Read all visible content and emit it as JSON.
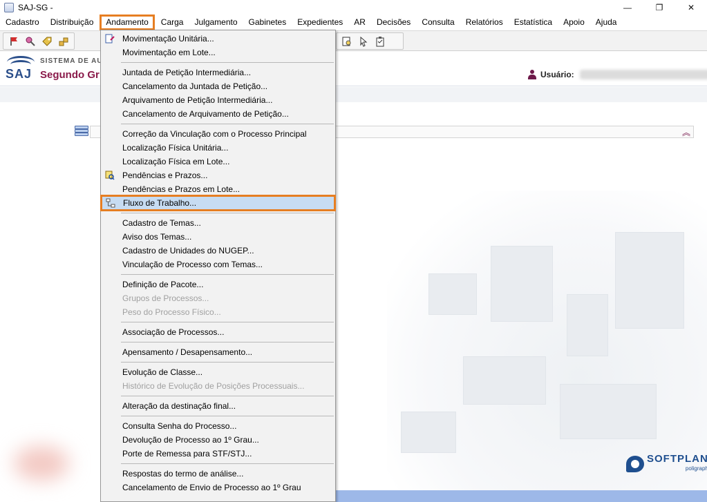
{
  "window": {
    "title": "SAJ-SG -",
    "minimize": "—",
    "restore": "❐",
    "close": "✕"
  },
  "menubar": {
    "items": [
      "Cadastro",
      "Distribuição",
      "Andamento",
      "Carga",
      "Julgamento",
      "Gabinetes",
      "Expedientes",
      "AR",
      "Decisões",
      "Consulta",
      "Relatórios",
      "Estatística",
      "Apoio",
      "Ajuda"
    ]
  },
  "header": {
    "logo_text": "SAJ",
    "system_name": "SISTEMA DE AUT",
    "subtitle": "Segundo Gr",
    "user_label": "Usuário:"
  },
  "brand": {
    "name": "SOFTPLAN",
    "sub": "poligraph"
  },
  "dropdown": {
    "group1": [
      "Movimentação Unitária...",
      "Movimentação em Lote..."
    ],
    "group2": [
      "Juntada de Petição Intermediária...",
      "Cancelamento da Juntada de Petição...",
      "Arquivamento de Petição Intermediária...",
      "Cancelamento de Arquivamento de Petição..."
    ],
    "group3": [
      "Correção da Vinculação com o Processo Principal",
      "Localização Física Unitária...",
      "Localização Física em Lote...",
      "Pendências e Prazos...",
      "Pendências e Prazos em Lote...",
      "Fluxo de Trabalho..."
    ],
    "group4": [
      "Cadastro de Temas...",
      "Aviso dos Temas...",
      "Cadastro de Unidades do NUGEP...",
      "Vinculação de Processo com Temas..."
    ],
    "group5": [
      "Definição de Pacote...",
      "Grupos de Processos...",
      "Peso do Processo Físico..."
    ],
    "group6": [
      "Associação de Processos..."
    ],
    "group7": [
      "Apensamento / Desapensamento..."
    ],
    "group8": [
      "Evolução de Classe...",
      "Histórico de Evolução de Posições Processuais..."
    ],
    "group9": [
      "Alteração da destinação final..."
    ],
    "group10": [
      "Consulta Senha do Processo...",
      "Devolução de Processo ao 1º Grau...",
      "Porte de Remessa para STF/STJ..."
    ],
    "group11": [
      "Respostas do termo de análise...",
      "Cancelamento de Envio de Processo ao 1º Grau"
    ]
  },
  "colors": {
    "highlight_outline": "#e67e22",
    "menu_selection": "#c7dcf2",
    "brand_blue": "#1f4f8f"
  }
}
